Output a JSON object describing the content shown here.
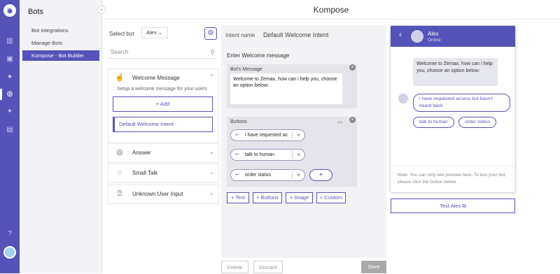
{
  "rail": {
    "icons": [
      "chat-logo-icon",
      "analytics-icon",
      "contacts-icon",
      "users-icon",
      "bots-icon",
      "integrations-icon",
      "docs-icon",
      "help-icon",
      "user-avatar-icon"
    ]
  },
  "sidebar": {
    "title": "Bots",
    "items": [
      {
        "label": "Bot Integrations"
      },
      {
        "label": "Manage Bots"
      },
      {
        "label": "Kompose - Bot Builder"
      }
    ]
  },
  "header": {
    "title": "Kompose"
  },
  "intents_panel": {
    "select_bot_label": "Select bot",
    "selected_bot": "Alex",
    "search_placeholder": "Search",
    "sections": [
      {
        "title": "Welcome Message",
        "subtitle": "Setup a welcome message for your users",
        "add_label": "+ Add",
        "intent": "Default Welcome Intent"
      },
      {
        "title": "Answer"
      },
      {
        "title": "Small Talk"
      },
      {
        "title": "Unknown User Input"
      }
    ]
  },
  "editor": {
    "intent_label": "Intent name",
    "intent_value": "Default Welcome Intent",
    "enter_label": "Enter Welcome message",
    "message_card_label": "Bot's Message",
    "message_text": "Welcome to Zemax, how can i help you, choose an option below:",
    "buttons_card_label": "Buttons",
    "buttons": [
      {
        "label": "i have requested ac"
      },
      {
        "label": "talk to human"
      },
      {
        "label": "order status"
      }
    ],
    "add_text": "+ Text",
    "add_buttons": "+ Buttons",
    "add_image": "+ Image",
    "add_custom": "+ Custom",
    "delete": "Delete",
    "discard": "Discard",
    "save": "Save"
  },
  "preview": {
    "bot_name": "Alex",
    "bot_status": "Online",
    "bot_message": "Welcome to Zemax, how can i help you, choose an option below:",
    "quick_replies": [
      {
        "label": "i have requested access but havn't heard back"
      },
      {
        "label": "talk to human"
      },
      {
        "label": "order status"
      }
    ],
    "note": "Note: You can only see preview here. To test your bot, please click the button below.",
    "test_button": "Test Alex"
  },
  "colors": {
    "accent": "#5553b7",
    "panel_bg": "#f3f3f6"
  }
}
